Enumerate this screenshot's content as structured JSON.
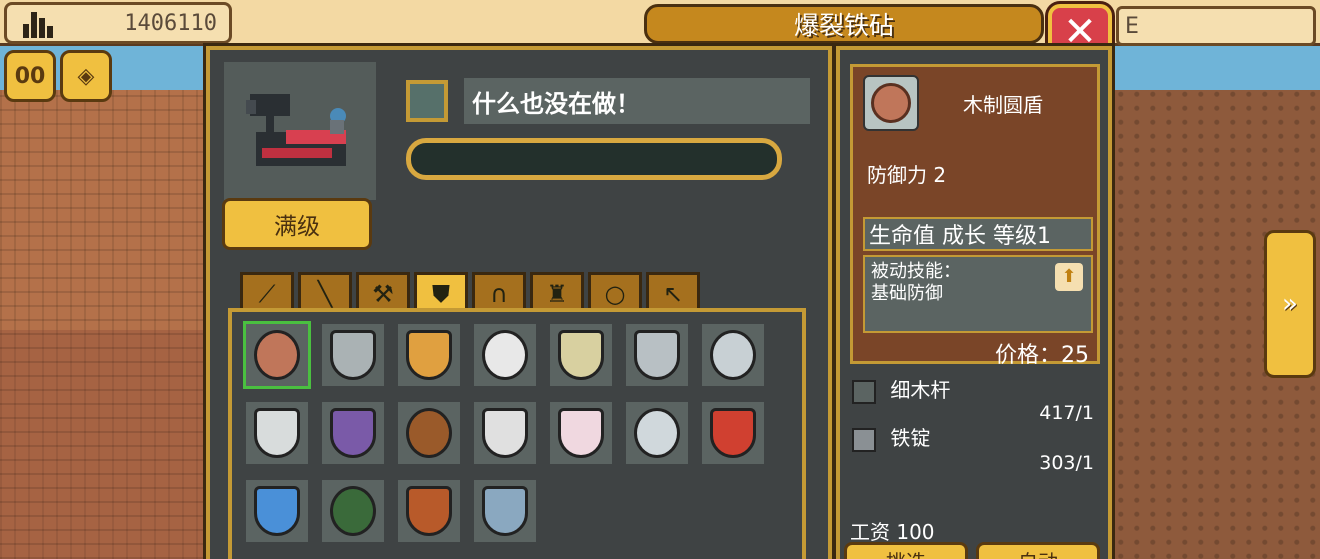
{
  "currency": {
    "icon": "building-icon",
    "value": "1406110"
  },
  "title": "爆裂铁砧",
  "right_tab_partial": "E",
  "left_buttons": [
    {
      "icon": "pause-icon",
      "label": "00"
    },
    {
      "icon": "gems-icon"
    }
  ],
  "machine": {
    "max_level_label": "满级"
  },
  "status": {
    "text": "什么也没在做！",
    "progress": 0
  },
  "tabs": [
    {
      "icon": "sword-icon",
      "active": false
    },
    {
      "icon": "staff-icon",
      "active": false
    },
    {
      "icon": "axe-icon",
      "active": false
    },
    {
      "icon": "shield-icon",
      "active": true
    },
    {
      "icon": "helmet-icon",
      "active": false
    },
    {
      "icon": "armor-icon",
      "active": false
    },
    {
      "icon": "ring-icon",
      "active": false
    },
    {
      "icon": "bow-icon",
      "active": false
    }
  ],
  "items": [
    {
      "icon": "wooden-round-shield-icon",
      "color": "#c0765a",
      "selected": true
    },
    {
      "icon": "silver-buckler-icon",
      "color": "#aab2b4"
    },
    {
      "icon": "heraldic-shield-icon",
      "color": "#e0a040"
    },
    {
      "icon": "white-kite-shield-icon",
      "color": "#e8e8e8"
    },
    {
      "icon": "cream-shield-icon",
      "color": "#d8d0a0"
    },
    {
      "icon": "steel-round-shield-icon",
      "color": "#b8c0c4"
    },
    {
      "icon": "half-silver-shield-icon",
      "color": "#c8d0d4"
    },
    {
      "icon": "tower-shield-icon",
      "color": "#d8dcdc"
    },
    {
      "icon": "purple-round-shield-icon",
      "color": "#7a5aa8"
    },
    {
      "icon": "spiked-bronze-shield-icon",
      "color": "#9a5a2a"
    },
    {
      "icon": "ornate-white-shield-icon",
      "color": "#e0e0e0"
    },
    {
      "icon": "cross-shield-icon",
      "color": "#f0d8e0"
    },
    {
      "icon": "winged-silver-shield-icon",
      "color": "#d0d8dc"
    },
    {
      "icon": "lion-shield-icon",
      "color": "#d04030"
    },
    {
      "icon": "blue-crest-shield-icon",
      "color": "#4a90d8"
    },
    {
      "icon": "green-dragon-shield-icon",
      "color": "#3a6a3a"
    },
    {
      "icon": "red-tower-shield-icon",
      "color": "#b85a2a"
    },
    {
      "icon": "frost-shield-icon",
      "color": "#8aa8c0"
    }
  ],
  "detail": {
    "name": "木制圆盾",
    "defense": "防御力 2",
    "growth": "生命值 成长 等级1",
    "skill_label": "被动技能：",
    "skill_name": "基础防御",
    "price": "价格：25"
  },
  "materials": [
    {
      "icon": "wood-stick-icon",
      "name": "细木杆",
      "qty": "417/1"
    },
    {
      "icon": "iron-ingot-icon",
      "name": "铁锭",
      "qty": "303/1"
    }
  ],
  "wage": "工资 100",
  "bottom_buttons": [
    "挑选",
    "自动"
  ],
  "side_arrow": "»"
}
